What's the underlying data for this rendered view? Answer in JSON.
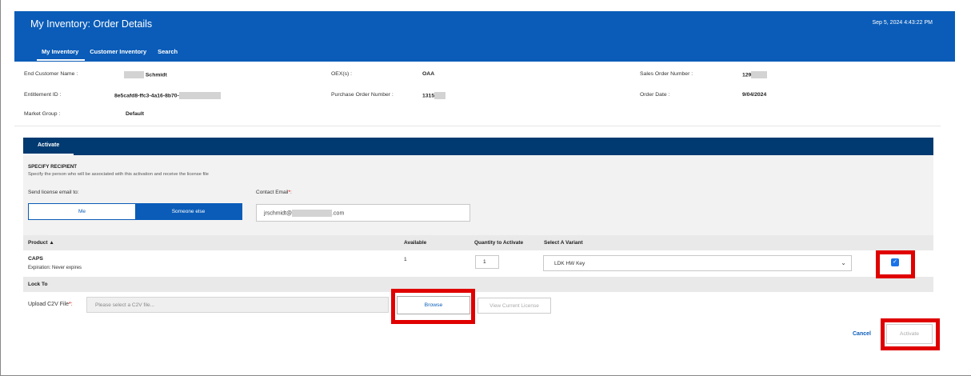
{
  "header": {
    "title": "My Inventory: Order Details",
    "timestamp": "Sep 5, 2024 4:43:22 PM",
    "tabs": [
      {
        "label": "My Inventory",
        "active": true
      },
      {
        "label": "Customer Inventory",
        "active": false
      },
      {
        "label": "Search",
        "active": false
      }
    ]
  },
  "order_info": {
    "end_customer_label": "End Customer Name :",
    "end_customer_value": "Schmidt",
    "entitlement_label": "Entitlement ID :",
    "entitlement_value": "8e5cafd8-ffc3-4a16-8b70-",
    "market_group_label": "Market Group :",
    "market_group_value": "Default",
    "oex_label": "OEX(s) :",
    "oex_value": "OAA",
    "po_label": "Purchase Order Number :",
    "po_value": "1315",
    "so_label": "Sales Order Number :",
    "so_value": "129",
    "order_date_label": "Order Date :",
    "order_date_value": "9/04/2024"
  },
  "activate_tab": "Activate",
  "recipient": {
    "title": "SPECIFY RECIPIENT",
    "subtitle": "Specify the person who will be associated with this activation and receive the license file",
    "send_label": "Send license email to:",
    "option_me": "Me",
    "option_else": "Someone else",
    "selected": "Someone else",
    "contact_label": "Contact Email",
    "required_mark": "*:",
    "email_prefix": "jrschmidt@",
    "email_suffix": ".com"
  },
  "product_table": {
    "headers": {
      "product": "Product ▲",
      "available": "Available",
      "quantity": "Quantity to Activate",
      "variant": "Select A Variant"
    },
    "rows": [
      {
        "product": "CAPS",
        "expiration": "Expiration: Never expires",
        "available": "1",
        "quantity": "1",
        "variant": "LDK HW Key",
        "selected": true
      }
    ]
  },
  "lock_to": {
    "label": "Lock To",
    "upload_label": "Upload C2V File",
    "required_mark": "*:",
    "placeholder": "Please select a C2V file...",
    "browse": "Browse",
    "view_license": "View Current License"
  },
  "actions": {
    "cancel": "Cancel",
    "activate": "Activate"
  },
  "colors": {
    "header_blue": "#0a5cb8",
    "activate_bar": "#003a70",
    "highlight_red": "#e00000"
  }
}
